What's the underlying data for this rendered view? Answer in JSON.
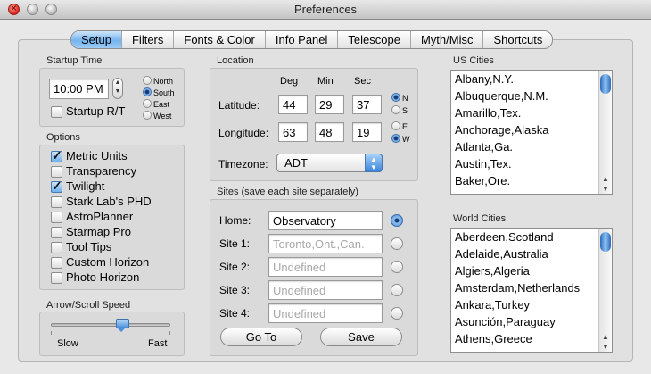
{
  "window": {
    "title": "Preferences"
  },
  "tabs": [
    "Setup",
    "Filters",
    "Fonts & Color",
    "Info Panel",
    "Telescope",
    "Myth/Misc",
    "Shortcuts"
  ],
  "startup": {
    "label": "Startup Time",
    "time": "10:00 PM",
    "startup_rt": "Startup R/T",
    "directions": [
      "North",
      "South",
      "East",
      "West"
    ],
    "selected_direction": "South"
  },
  "options": {
    "label": "Options",
    "items": [
      {
        "label": "Metric Units",
        "checked": true
      },
      {
        "label": "Transparency",
        "checked": false
      },
      {
        "label": "Twilight",
        "checked": true
      },
      {
        "label": "Stark Lab's PHD",
        "checked": false
      },
      {
        "label": "AstroPlanner",
        "checked": false
      },
      {
        "label": "Starmap Pro",
        "checked": false
      },
      {
        "label": "Tool Tips",
        "checked": false
      },
      {
        "label": "Custom Horizon",
        "checked": false
      },
      {
        "label": "Photo Horizon",
        "checked": false
      }
    ]
  },
  "speed": {
    "label": "Arrow/Scroll Speed",
    "slow": "Slow",
    "fast": "Fast",
    "level": 0.6
  },
  "location": {
    "label": "Location",
    "cols": [
      "Deg",
      "Min",
      "Sec"
    ],
    "latitude": {
      "label": "Latitude:",
      "deg": "44",
      "min": "29",
      "sec": "37",
      "ns": [
        "N",
        "S"
      ],
      "selected": "N"
    },
    "longitude": {
      "label": "Longitude:",
      "deg": "63",
      "min": "48",
      "sec": "19",
      "ew": [
        "E",
        "W"
      ],
      "selected": "W"
    },
    "timezone_label": "Timezone:",
    "timezone": "ADT"
  },
  "sites": {
    "label": "Sites (save each site separately)",
    "rows": [
      {
        "label": "Home:",
        "value": "Observatory",
        "selected": true
      },
      {
        "label": "Site 1:",
        "value": "Toronto,Ont.,Can.",
        "selected": false
      },
      {
        "label": "Site 2:",
        "value": "Undefined",
        "selected": false
      },
      {
        "label": "Site 3:",
        "value": "Undefined",
        "selected": false
      },
      {
        "label": "Site 4:",
        "value": "Undefined",
        "selected": false
      }
    ],
    "goto": "Go To",
    "save": "Save"
  },
  "us_cities": {
    "label": "US Cities",
    "items": [
      "Albany,N.Y.",
      "Albuquerque,N.M.",
      "Amarillo,Tex.",
      "Anchorage,Alaska",
      "Atlanta,Ga.",
      "Austin,Tex.",
      "Baker,Ore."
    ]
  },
  "world_cities": {
    "label": "World Cities",
    "items": [
      "Aberdeen,Scotland",
      "Adelaide,Australia",
      "Algiers,Algeria",
      "Amsterdam,Netherlands",
      "Ankara,Turkey",
      "Asunción,Paraguay",
      "Athens,Greece"
    ]
  },
  "colors": {
    "accent": "#4c8fd6",
    "tab_active": "#74b4ee"
  }
}
